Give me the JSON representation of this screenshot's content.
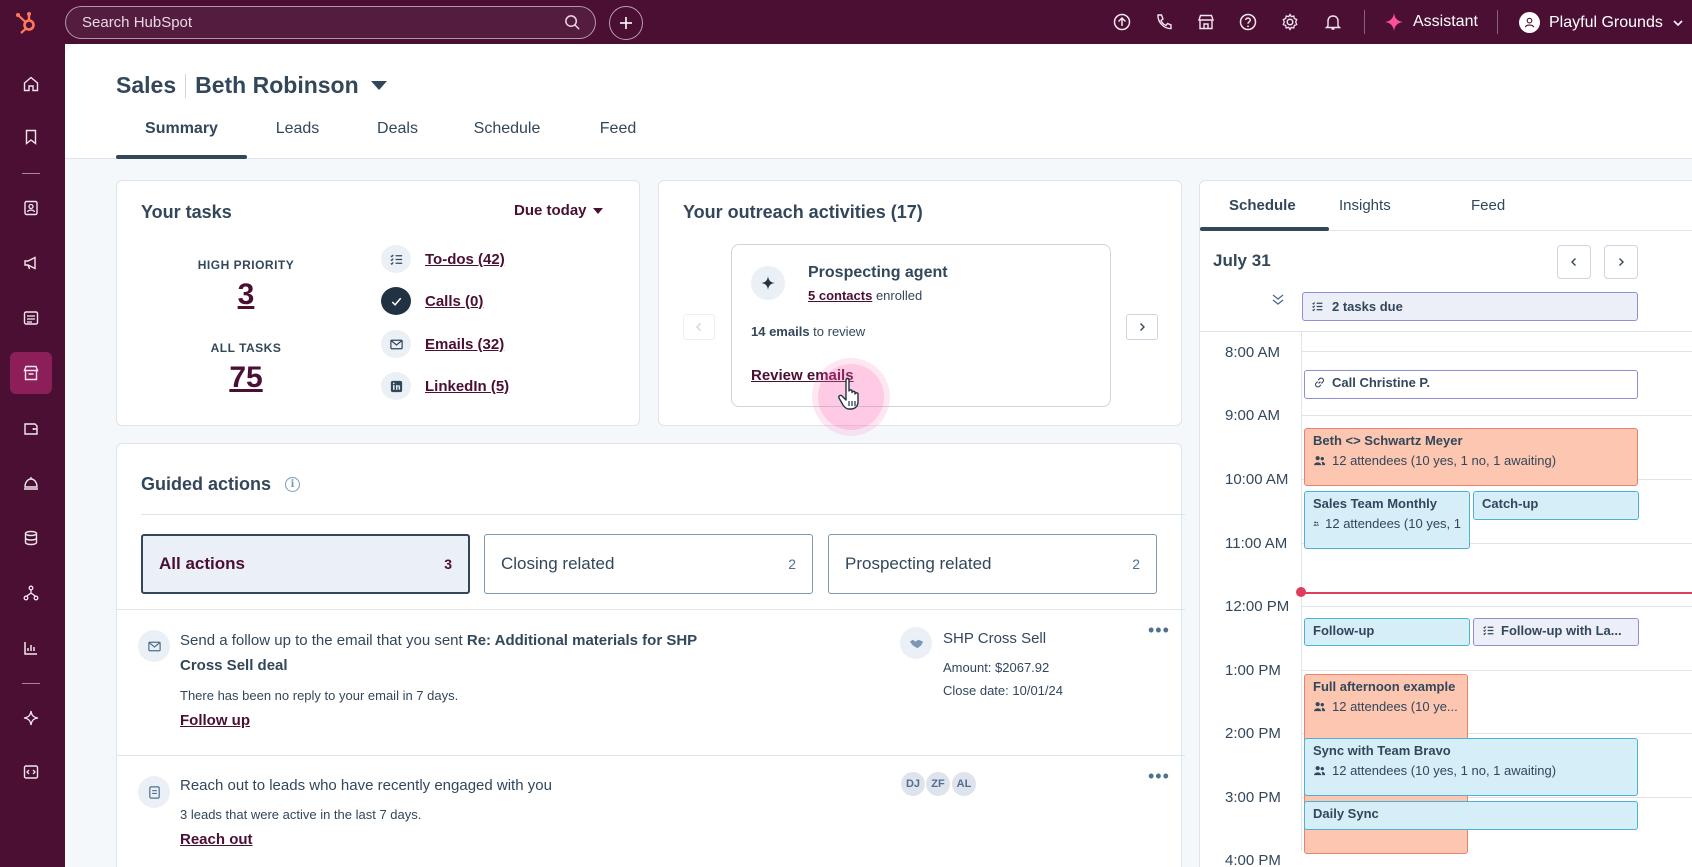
{
  "topbar": {
    "search_placeholder": "Search HubSpot",
    "assistant_label": "Assistant",
    "account_name": "Playful Grounds"
  },
  "header": {
    "section": "Sales",
    "owner": "Beth Robinson",
    "tabs": [
      "Summary",
      "Leads",
      "Deals",
      "Schedule",
      "Feed"
    ]
  },
  "tasks": {
    "title": "Your tasks",
    "filter": "Due today",
    "high_priority_label": "HIGH PRIORITY",
    "high_priority_count": "3",
    "all_tasks_label": "ALL TASKS",
    "all_tasks_count": "75",
    "links": [
      "To-dos (42)",
      "Calls (0)",
      "Emails (32)",
      "LinkedIn (5)"
    ]
  },
  "outreach": {
    "title": "Your outreach activities (17)",
    "agent_name": "Prospecting agent",
    "contacts_link": "5 contacts",
    "contacts_suffix": "enrolled",
    "emails_count": "14 emails",
    "emails_suffix": "to review",
    "review_link": "Review emails"
  },
  "guided": {
    "title": "Guided actions",
    "filters": [
      {
        "label": "All actions",
        "count": "3"
      },
      {
        "label": "Closing related",
        "count": "2"
      },
      {
        "label": "Prospecting related",
        "count": "2"
      }
    ],
    "actions": [
      {
        "text_prefix": "Send a follow up to the email that you sent",
        "text_bold": "Re: Additional materials for SHP Cross Sell deal",
        "sub": "There has been no reply to your email in 7 days.",
        "link": "Follow up",
        "deal_name": "SHP Cross Sell",
        "deal_amount": "Amount: $2067.92",
        "deal_close": "Close date: 10/01/24"
      },
      {
        "text_prefix": "Reach out to leads who have recently engaged with you",
        "sub": "3 leads that were active in the last 7 days.",
        "link": "Reach out",
        "avatars": [
          "DJ",
          "ZF",
          "AL"
        ]
      }
    ]
  },
  "schedule": {
    "tabs": [
      "Schedule",
      "Insights",
      "Feed"
    ],
    "date": "July 31",
    "all_day": "2 tasks due",
    "hours": [
      "8:00 AM",
      "9:00 AM",
      "10:00 AM",
      "11:00 AM",
      "12:00 PM",
      "1:00 PM",
      "2:00 PM",
      "3:00 PM",
      "4:00 PM"
    ],
    "events": [
      {
        "title": "Call Christine P."
      },
      {
        "title": "Beth <> Schwartz Meyer",
        "sub": "12 attendees (10 yes, 1 no, 1 awaiting)"
      },
      {
        "title": "Sales Team Monthly",
        "sub": "12 attendees (10 yes, 1"
      },
      {
        "title": "Catch-up"
      },
      {
        "title": "Follow-up"
      },
      {
        "title": "Follow-up with La..."
      },
      {
        "title": "Full afternoon example",
        "sub": "12 attendees (10 ye..."
      },
      {
        "title": "Sync with Team Bravo",
        "sub": "12 attendees (10 yes, 1 no, 1 awaiting)"
      },
      {
        "title": "Daily Sync"
      }
    ]
  },
  "colors": {
    "brand_nav": "#4a0f33",
    "accent_link": "#4a0f33",
    "logo": "#ff7a59",
    "event_orange": "#fcc6b0",
    "event_blue": "#d6eef8",
    "event_purple": "#eceff7",
    "now_line": "#e03c5c"
  },
  "icons": [
    "hubspot-logo-icon",
    "search-icon",
    "plus-icon",
    "upgrade-icon",
    "phone-icon",
    "marketplace-icon",
    "help-icon",
    "settings-icon",
    "bell-icon",
    "sparkle-icon",
    "user-icon",
    "chevron-down-icon"
  ]
}
